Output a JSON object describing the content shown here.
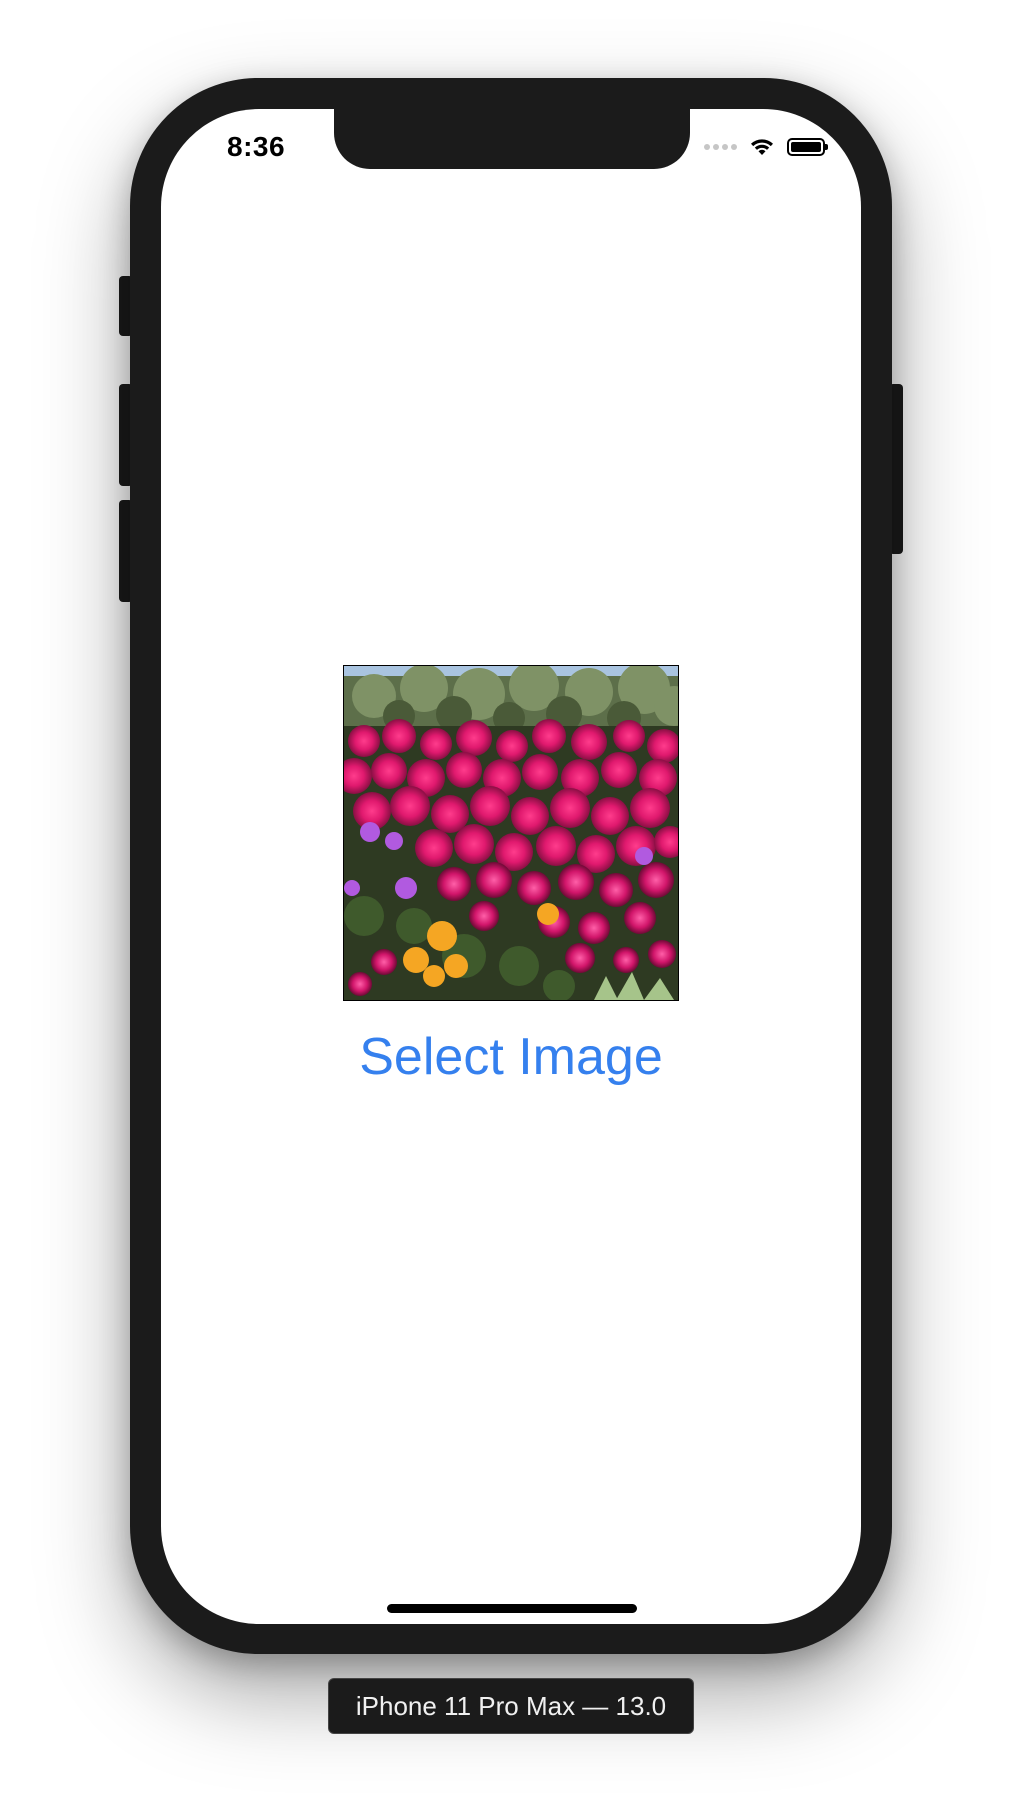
{
  "status_bar": {
    "time": "8:36",
    "icons": [
      "cellular-dots-icon",
      "wifi-icon",
      "battery-icon"
    ],
    "battery_level": 1.0
  },
  "main": {
    "image_alt": "flowers-photo",
    "select_button_label": "Select Image",
    "accent_color": "#3580ee"
  },
  "device_label": "iPhone 11 Pro Max — 13.0"
}
